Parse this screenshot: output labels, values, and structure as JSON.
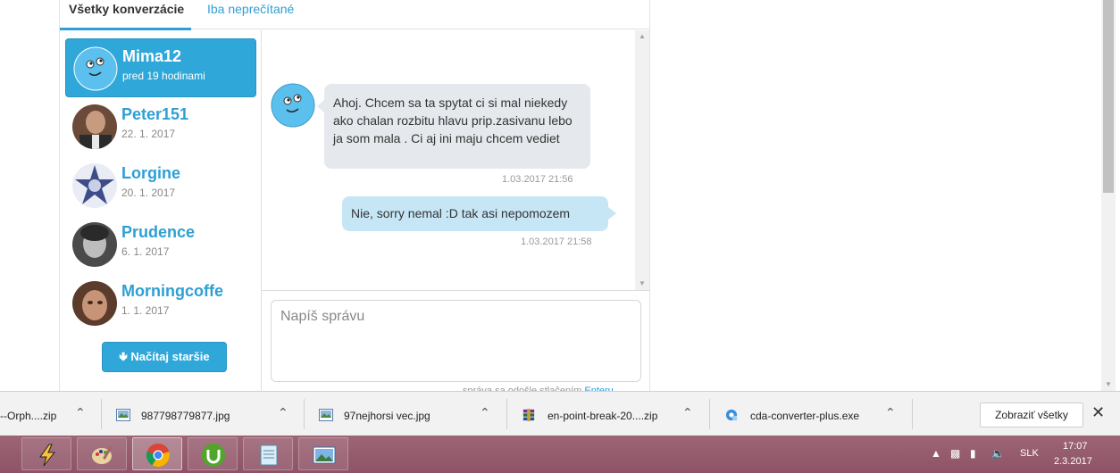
{
  "tabs": {
    "all": "Všetky konverzácie",
    "unread": "Iba neprečítané"
  },
  "conversations": [
    {
      "name": "Mima12",
      "date": "pred 19 hodinami",
      "active": true
    },
    {
      "name": "Peter151",
      "date": "22. 1. 2017",
      "active": false
    },
    {
      "name": "Lorgine",
      "date": "20. 1. 2017",
      "active": false
    },
    {
      "name": "Prudence",
      "date": "6. 1. 2017",
      "active": false
    },
    {
      "name": "Morningcoffe",
      "date": "1. 1. 2017",
      "active": false
    }
  ],
  "load_older": "Načítaj staršie",
  "messages": [
    {
      "direction": "in",
      "text": "Ahoj. Chcem sa ta spytat ci si mal niekedy ako chalan rozbitu hlavu prip.zasivanu lebo ja som mala . Ci aj ini maju chcem vediet",
      "time": "1.03.2017 21:56"
    },
    {
      "direction": "out",
      "text": "Nie, sorry nemal :D tak asi nepomozem",
      "time": "1.03.2017 21:58"
    }
  ],
  "compose": {
    "placeholder": "Napíš správu",
    "hint_prefix": "správa sa odošle stlačením",
    "hint_link": "Enteru"
  },
  "downloads": [
    {
      "name": "--Orph....zip",
      "icon": "archive-icon"
    },
    {
      "name": "987798779877.jpg",
      "icon": "image-file-icon"
    },
    {
      "name": "97nejhorsi vec.jpg",
      "icon": "image-file-icon"
    },
    {
      "name": "en-point-break-20....zip",
      "icon": "winrar-icon"
    },
    {
      "name": "cda-converter-plus.exe",
      "icon": "installer-icon"
    }
  ],
  "show_all": "Zobraziť všetky",
  "taskbar": {
    "apps": [
      "winamp",
      "paint",
      "chrome",
      "utorrent",
      "notepad",
      "photo-viewer"
    ],
    "lang": "SLK",
    "time": "17:07",
    "date": "2.3.2017"
  },
  "colors": {
    "accent": "#2fa7d9",
    "bubble_in": "#e5e8ec",
    "bubble_out": "#c6e6f6",
    "taskbar": "#8e5366"
  }
}
